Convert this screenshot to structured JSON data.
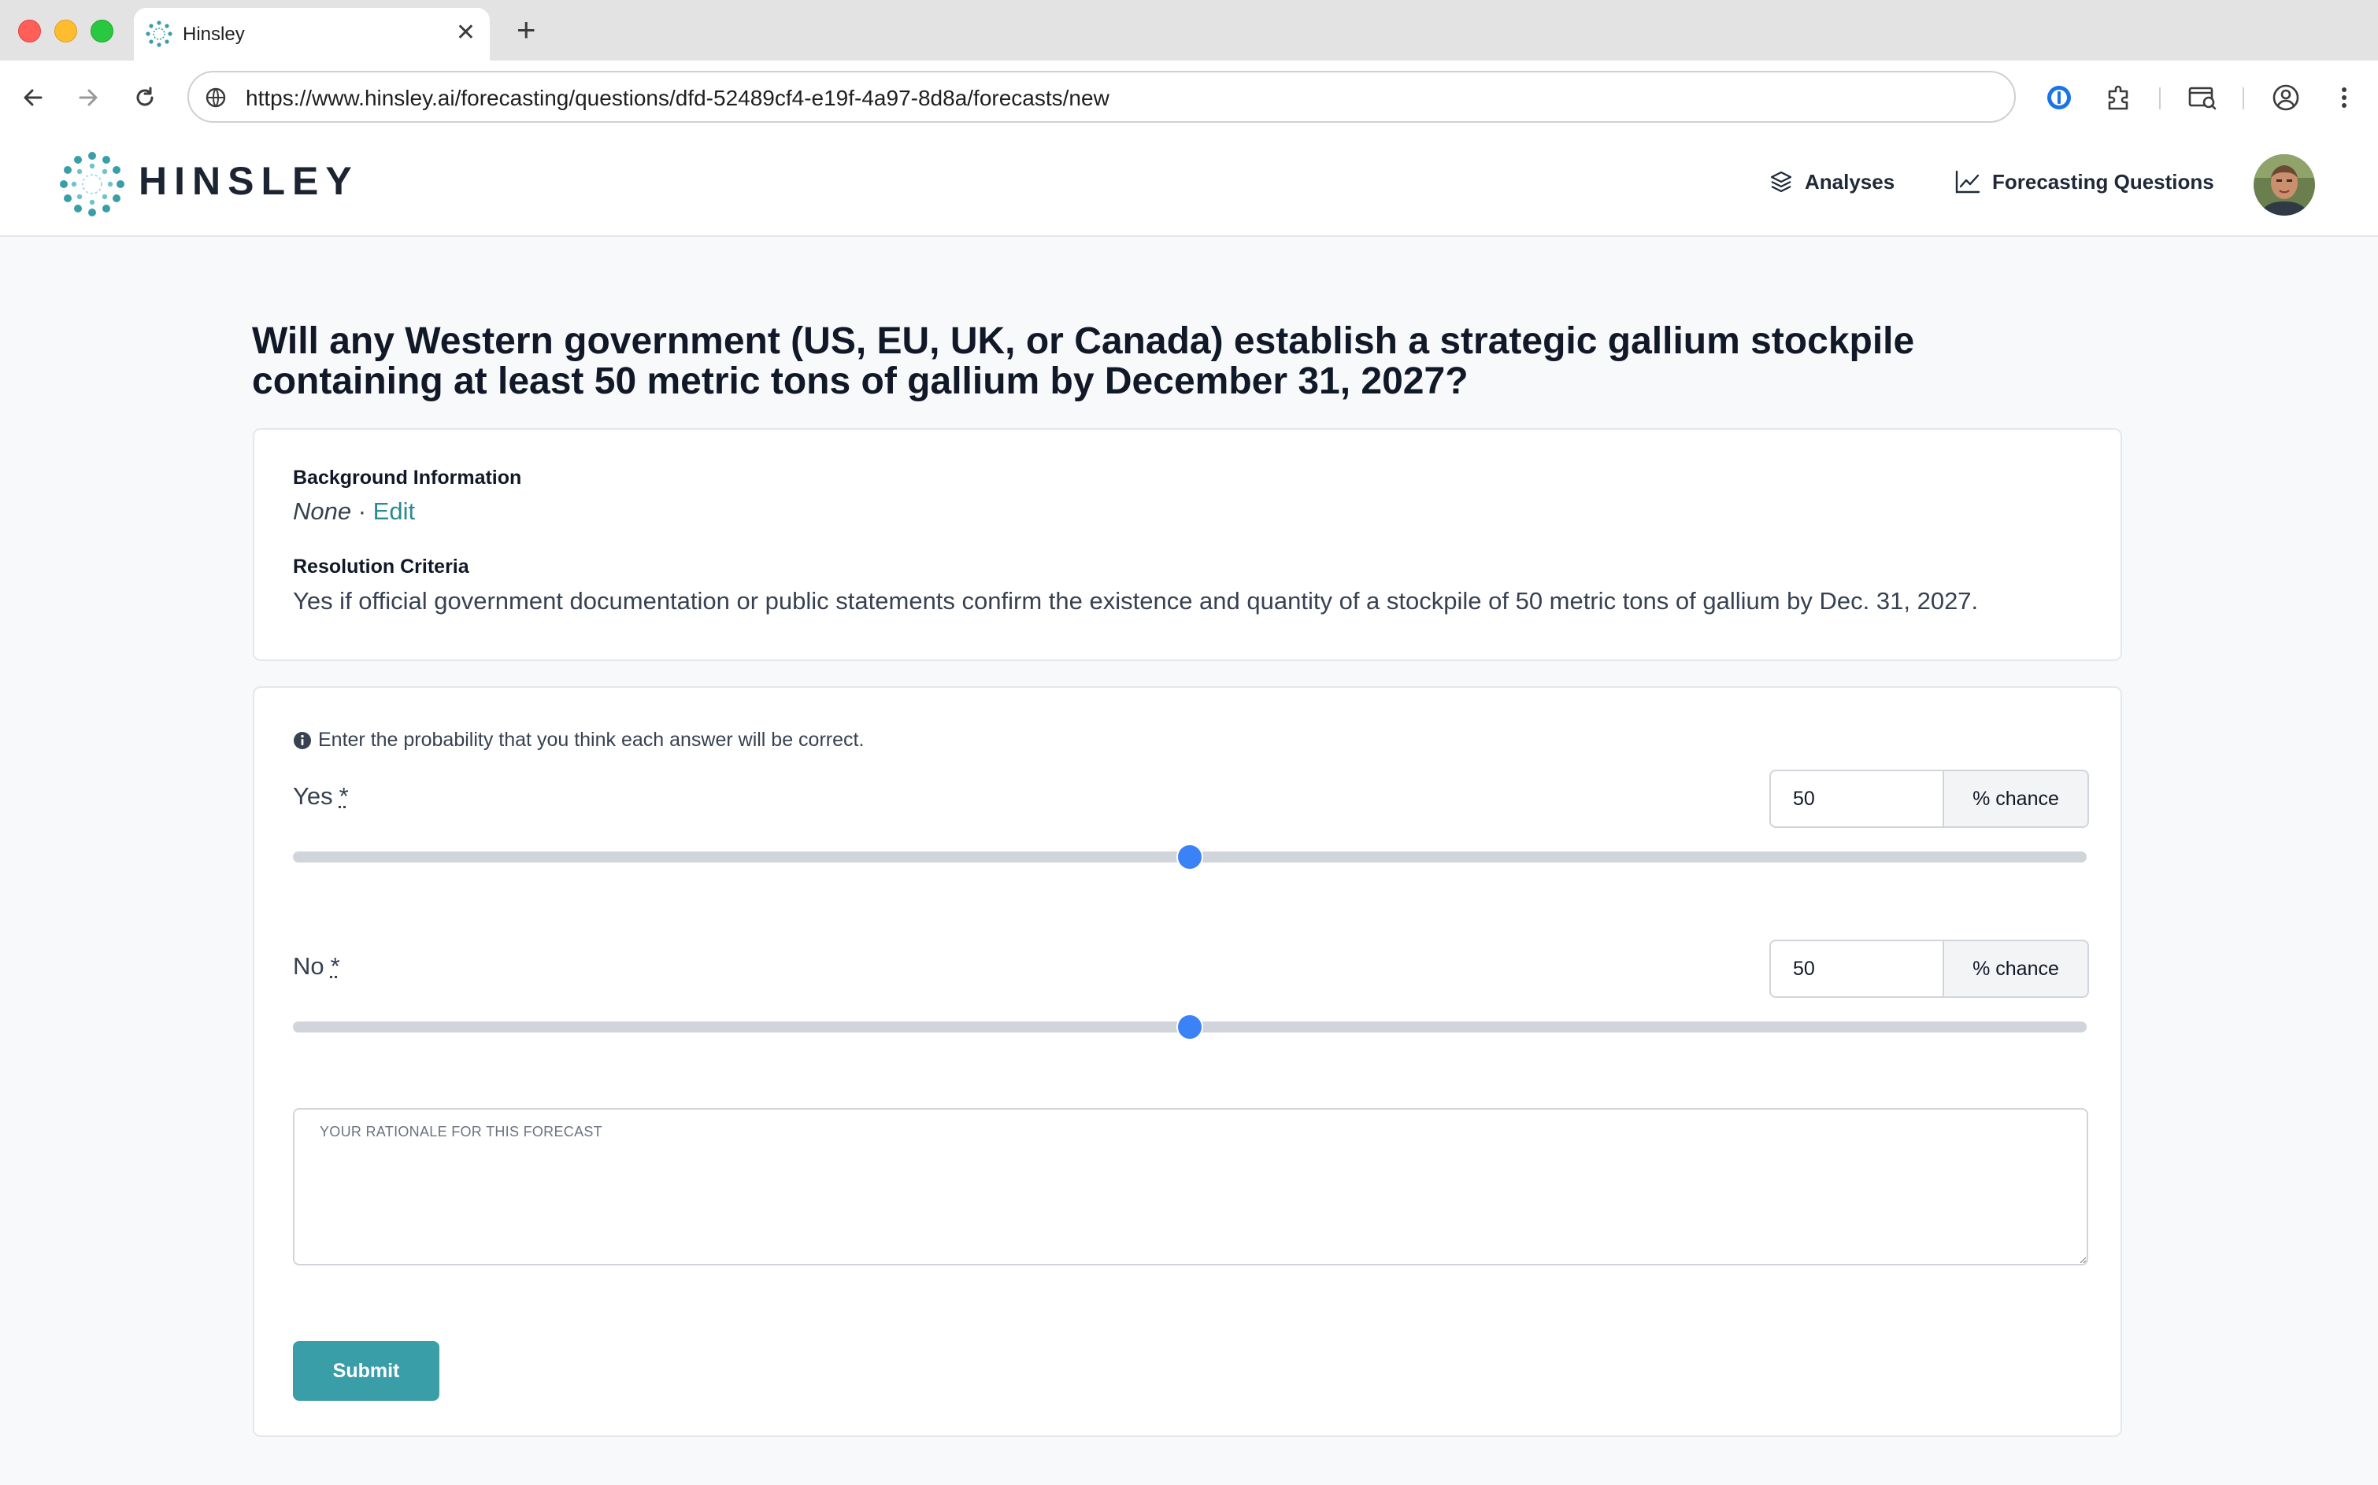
{
  "browser": {
    "tab_title": "Hinsley",
    "url": "https://www.hinsley.ai/forecasting/questions/dfd-52489cf4-e19f-4a97-8d8a/forecasts/new",
    "new_tab_symbol": "+",
    "close_symbol": "✕"
  },
  "header": {
    "logo_text": "HINSLEY",
    "nav": [
      {
        "label": "Analyses",
        "icon": "layers-icon"
      },
      {
        "label": "Forecasting Questions",
        "icon": "line-chart-icon"
      }
    ]
  },
  "question": {
    "title": "Will any Western government (US, EU, UK, or Canada) establish a strategic gallium stockpile containing at least 50 metric tons of gallium by December 31, 2027?",
    "background_label": "Background Information",
    "background_value": "None",
    "separator": " · ",
    "edit_label": "Edit",
    "resolution_label": "Resolution Criteria",
    "resolution_value": "Yes if official government documentation or public statements confirm the existence and quantity of a stockpile of 50 metric tons of gallium by Dec. 31, 2027."
  },
  "form": {
    "hint": "Enter the probability that you think each answer will be correct.",
    "answers": [
      {
        "label": "Yes",
        "required_mark": "*",
        "value": "50",
        "percent": 50,
        "addon": "% chance"
      },
      {
        "label": "No",
        "required_mark": "*",
        "value": "50",
        "percent": 50,
        "addon": "% chance"
      }
    ],
    "rationale_placeholder": "Your rationale for this forecast",
    "submit_label": "Submit"
  },
  "colors": {
    "accent": "#3a9ea8",
    "slider_thumb": "#3b82f6",
    "link": "#2b8a94"
  }
}
